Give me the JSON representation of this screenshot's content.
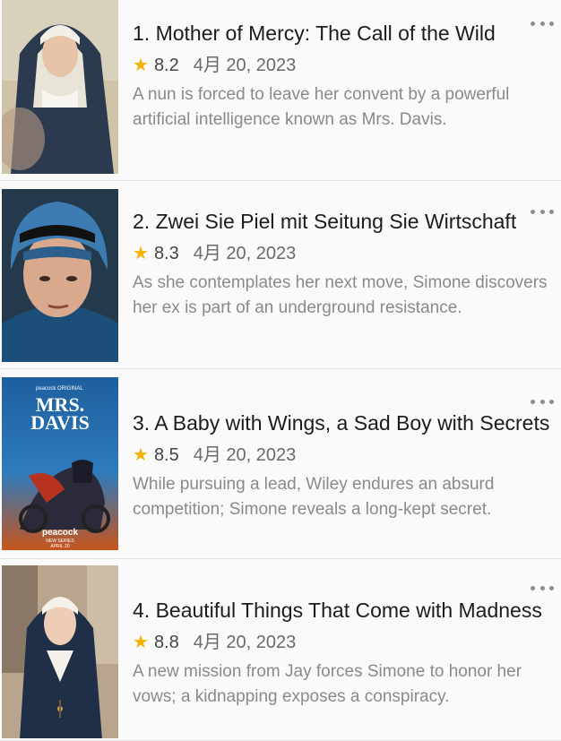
{
  "episodes": [
    {
      "title": "1. Mother of Mercy: The Call of the Wild",
      "rating": "8.2",
      "date": "4月 20, 2023",
      "description": "A nun is forced to leave her convent by a powerful artificial intelligence known as Mrs. Davis.",
      "thumbnail": "nun-portrait"
    },
    {
      "title": "2. Zwei Sie Piel mit Seitung Sie Wirtschaft",
      "rating": "8.3",
      "date": "4月 20, 2023",
      "description": "As she contemplates her next move, Simone discovers her ex is part of an underground resistance.",
      "thumbnail": "helmet-rider"
    },
    {
      "title": "3. A Baby with Wings, a Sad Boy with Secrets",
      "rating": "8.5",
      "date": "4月 20, 2023",
      "description": "While pursuing a lead, Wiley endures an absurd competition; Simone reveals a long-kept secret.",
      "thumbnail": "series-poster",
      "poster": {
        "brand_top": "peacock ORIGINAL",
        "title_line1": "MRS.",
        "title_line2": "DAVIS",
        "brand_bottom": "peacock",
        "tagline1": "NEW SERIES",
        "tagline2": "APRIL 20"
      }
    },
    {
      "title": "4. Beautiful Things That Come with Madness",
      "rating": "8.8",
      "date": "4月 20, 2023",
      "description": "A new mission from Jay forces Simone to honor her vows; a kidnapping exposes a conspiracy.",
      "thumbnail": "nun-street"
    }
  ],
  "colors": {
    "star": "#f1b300",
    "poster_blue": "#1e5f9e",
    "poster_orange": "#c9541a"
  },
  "icons": {
    "rating": "star-icon",
    "menu": "more-options-icon"
  }
}
